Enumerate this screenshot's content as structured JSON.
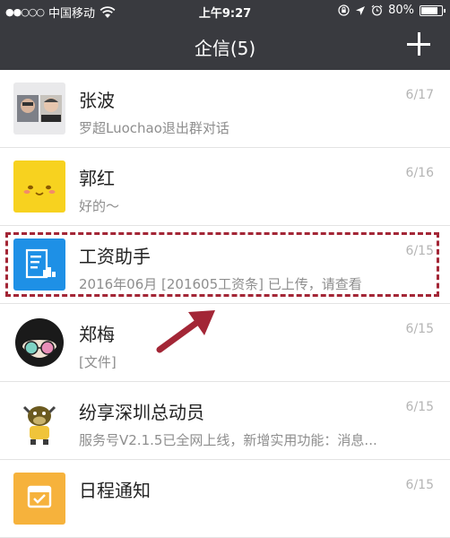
{
  "status_bar": {
    "signal_dots": "●●○○○",
    "carrier": "中国移动",
    "time": "上午9:27",
    "battery_percent_label": "80%",
    "battery_level": 0.8
  },
  "nav": {
    "title": "企信(5)",
    "plus_icon": "plus-icon"
  },
  "chats": [
    {
      "name": "张波",
      "message": "罗超Luochao退出群对话",
      "date": "6/17",
      "avatar": "group-photo-avatar"
    },
    {
      "name": "郭红",
      "message": "好的～",
      "date": "6/16",
      "avatar": "yellow-face-avatar"
    },
    {
      "name": "工资助手",
      "message": "2016年06月 [201605工资条] 已上传，请查看",
      "date": "6/15",
      "avatar": "payslip-icon"
    },
    {
      "name": "郑梅",
      "message": "[文件]",
      "date": "6/15",
      "avatar": "sunglasses-cartoon-avatar"
    },
    {
      "name": "纷享深圳总动员",
      "message": "服务号V2.1.5已全网上线，新增实用功能：消息...",
      "date": "6/15",
      "avatar": "bull-mascot-avatar"
    },
    {
      "name": "日程通知",
      "message": "",
      "date": "6/15",
      "avatar": "calendar-check-icon"
    }
  ],
  "colors": {
    "nav_bg": "#393a3f",
    "highlight": "#a32636",
    "payslip_blue": "#1e90e6",
    "calendar_orange": "#f6b23c",
    "yellow_avatar": "#f7d21f"
  }
}
